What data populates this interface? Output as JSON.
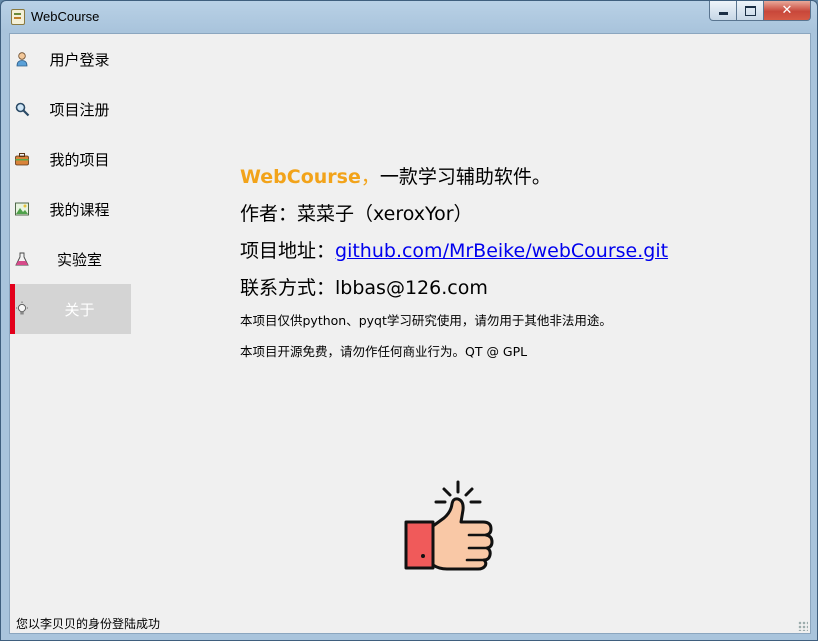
{
  "window": {
    "title": "WebCourse"
  },
  "sidebar": {
    "items": [
      {
        "label": "用户登录",
        "icon": "user-icon"
      },
      {
        "label": "项目注册",
        "icon": "search-icon"
      },
      {
        "label": "我的项目",
        "icon": "briefcase-icon"
      },
      {
        "label": "我的课程",
        "icon": "picture-icon"
      },
      {
        "label": "实验室",
        "icon": "flask-icon"
      },
      {
        "label": "关于",
        "icon": "lightbulb-icon",
        "active": true
      }
    ]
  },
  "about": {
    "brand": "WebCourse",
    "brand_sep": "，",
    "tagline": "一款学习辅助软件。",
    "author_label": "作者：",
    "author_value": "菜菜子（xeroxYor）",
    "address_label": "项目地址：",
    "address_link": "github.com/MrBeike/webCourse.git",
    "contact_label": "联系方式：",
    "contact_value": "lbbas@126.com",
    "note1": "本项目仅供python、pyqt学习研究使用，请勿用于其他非法用途。",
    "note2": "本项目开源免费，请勿作任何商业行为。QT @ GPL",
    "image_icon": "thumbs-up-icon"
  },
  "status": {
    "message": "您以李贝贝的身份登陆成功"
  },
  "colors": {
    "accent": "#f2a31a",
    "active_marker": "#e3001b",
    "link": "#0000ee"
  }
}
